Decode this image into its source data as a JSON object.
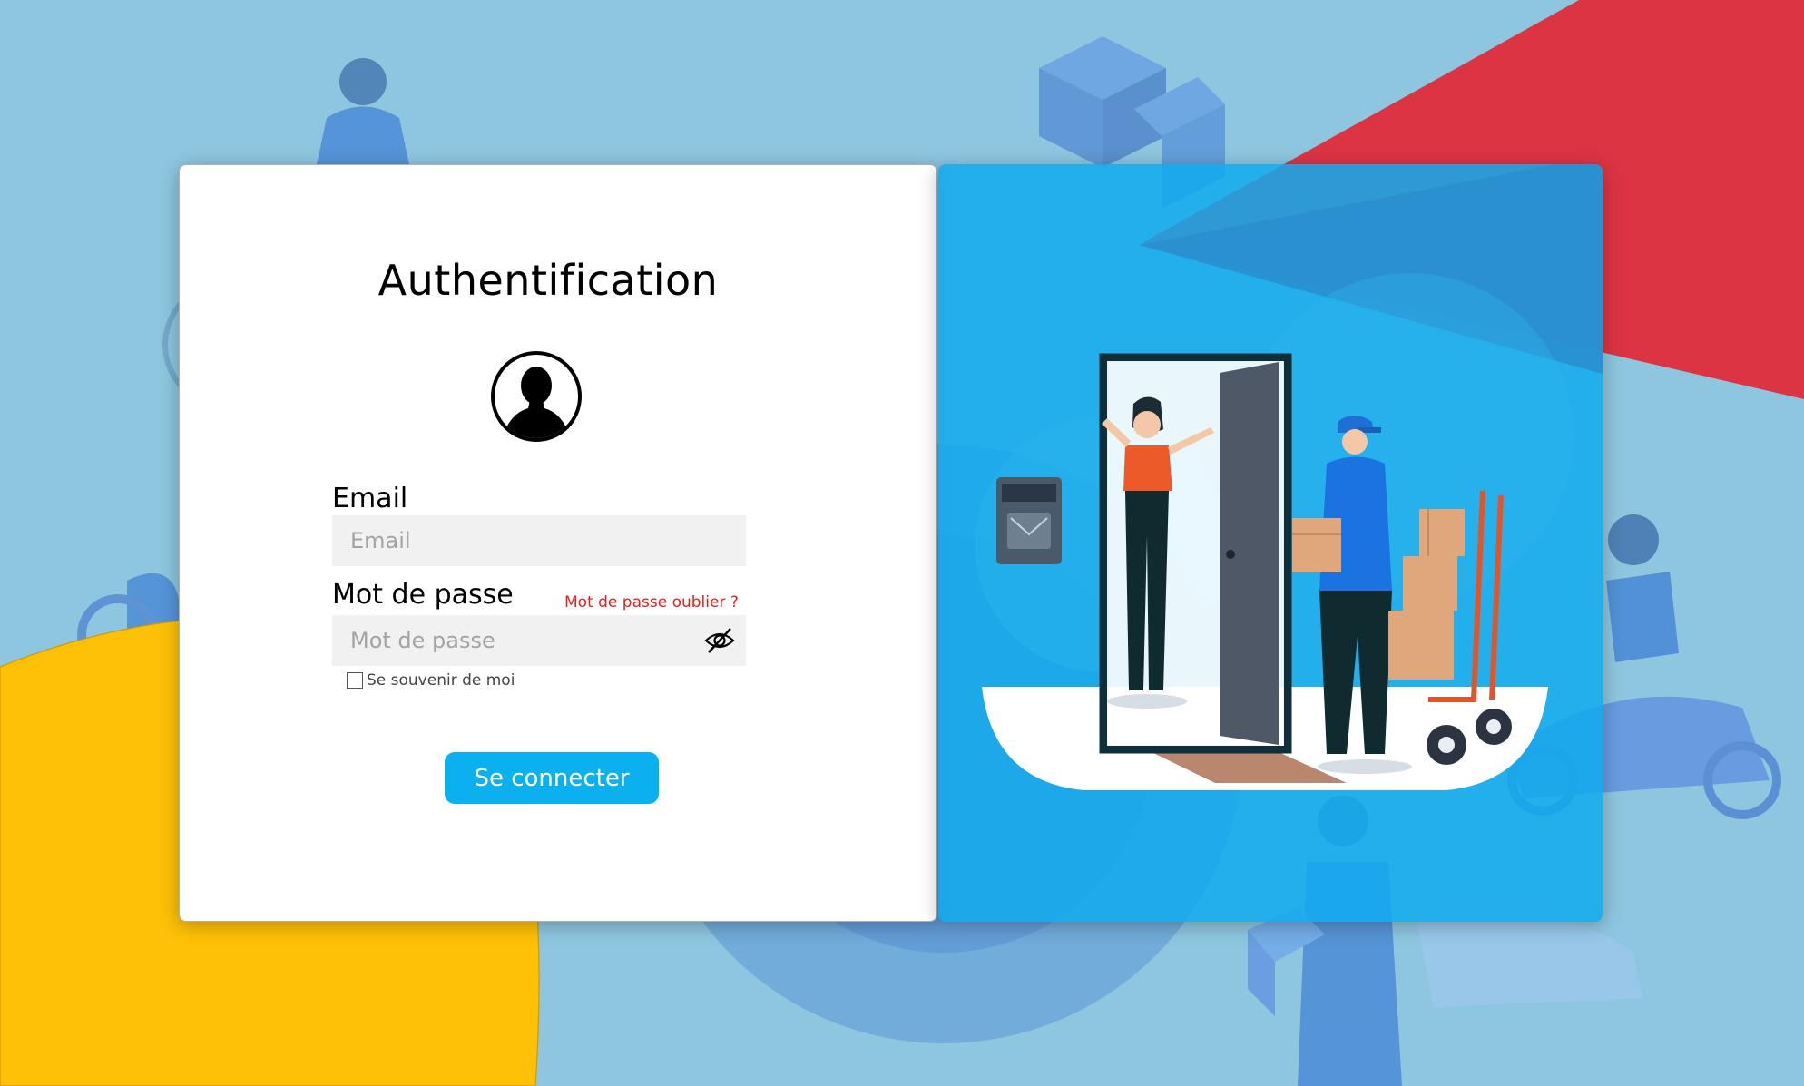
{
  "login": {
    "title": "Authentification",
    "email_label": "Email",
    "email_placeholder": "Email",
    "email_value": "",
    "password_label": "Mot de passe",
    "password_placeholder": "Mot de passe",
    "password_value": "",
    "forgot_password": "Mot de passe oublier ?",
    "remember_me": "Se souvenir de moi",
    "remember_checked": false,
    "submit_label": "Se connecter"
  },
  "icons": {
    "avatar": "user-silhouette-icon",
    "password_toggle": "eye-slash-icon"
  },
  "colors": {
    "background": "#8ec6e0",
    "accent_red": "#dd3444",
    "accent_yellow": "#ffc107",
    "button": "#0bb1ee",
    "panel": "#11aaee",
    "link": "#e2211c"
  }
}
